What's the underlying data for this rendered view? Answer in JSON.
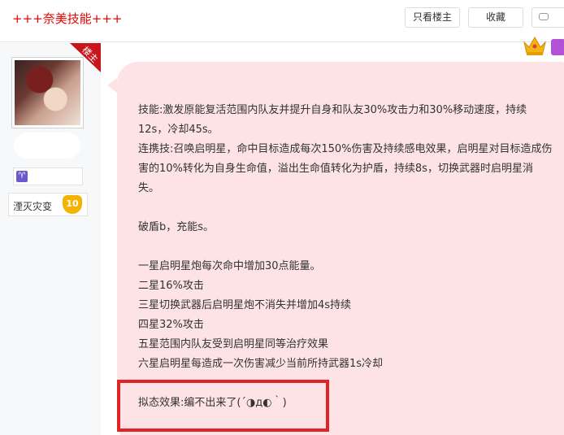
{
  "thread": {
    "title": "+++奈美技能+++"
  },
  "toolbar": {
    "only_lz": "只看楼主",
    "favorite": "收藏"
  },
  "author": {
    "badge": "楼主",
    "zodiac": "♈",
    "rank_label": "湮灭灾变",
    "level": "10"
  },
  "post": {
    "skill": "技能:激发原能复活范围内队友并提升自身和队友30%攻击力和30%移动速度，持续12s，冷却45s。",
    "combo": "连携技:召唤启明星，命中目标造成每次150%伤害及持续感电效果，启明星对目标造成伤害的10%转化为自身生命值，溢出生命值转化为护盾，持续8s，切换武器时启明星消失。",
    "shield": "破盾b，充能s。",
    "star_1": "一星启明星炮每次命中增加30点能量。",
    "star_2": "二星16%攻击",
    "star_3": "三星切换武器后启明星炮不消失并增加4s持续",
    "star_4": "四星32%攻击",
    "star_5": "五星范围内队友受到启明星同等治疗效果",
    "star_6": "六星启明星每造成一次伤害减少当前所持武器1s冷却",
    "mimic": "拟态效果:编不出来了(´◑д◐｀)"
  },
  "colors": {
    "title_red": "#e10602",
    "bubble_pink": "#fde2e6",
    "highlight_red": "#e02424"
  }
}
